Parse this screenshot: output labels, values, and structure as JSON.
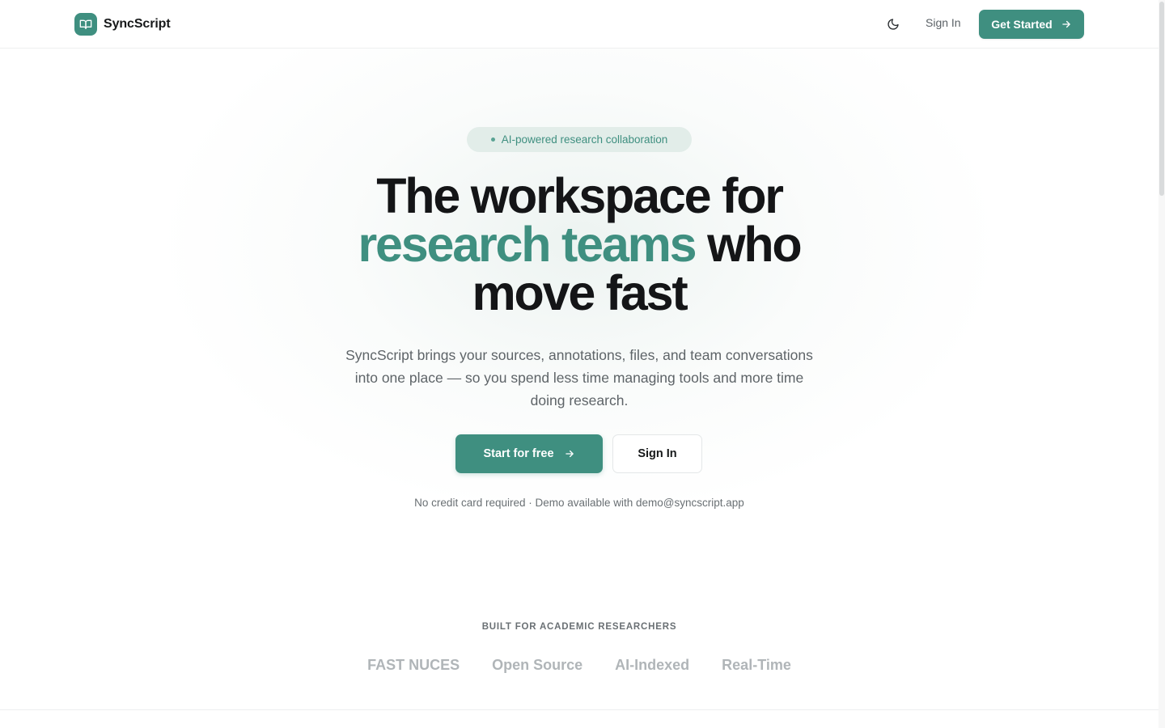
{
  "brand": {
    "name": "SyncScript",
    "logo_icon": "book-open-icon",
    "accent_color": "#3f8f80"
  },
  "nav": {
    "theme_toggle_icon": "moon-icon",
    "signin_label": "Sign In",
    "get_started_label": "Get Started",
    "get_started_icon": "arrow-right-icon"
  },
  "hero": {
    "badge": "AI-powered research collaboration",
    "headline_line1": "The workspace for",
    "headline_accent": "research teams",
    "headline_line2_rest": " who",
    "headline_line3": "move fast",
    "subhead": "SyncScript brings your sources, annotations, files, and team conversations into one place — so you spend less time managing tools and more time doing research.",
    "cta_primary": "Start for free",
    "cta_primary_icon": "arrow-right-icon",
    "cta_secondary": "Sign In",
    "fineprint": "No credit card required · Demo available with demo@syncscript.app"
  },
  "social_proof": {
    "heading": "BUILT FOR ACADEMIC RESEARCHERS",
    "items": [
      "FAST NUCES",
      "Open Source",
      "AI-Indexed",
      "Real-Time"
    ]
  }
}
